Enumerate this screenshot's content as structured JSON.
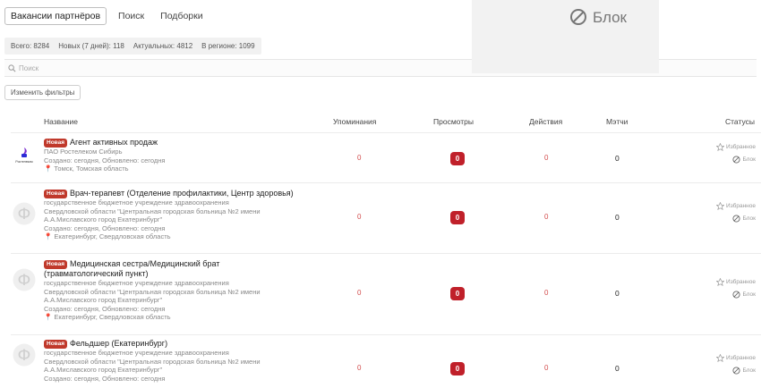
{
  "tabs": [
    {
      "label": "Вакансии партнёров",
      "active": true
    },
    {
      "label": "Поиск",
      "active": false
    },
    {
      "label": "Подборки",
      "active": false
    }
  ],
  "stats": [
    "Всего: 8284",
    "Новых (7 дней): 118",
    "Актуальных: 4812",
    "В регионе: 1099"
  ],
  "search": {
    "placeholder": "Поиск"
  },
  "filters_button": "Изменить фильтры",
  "overlay": {
    "label": "Блок"
  },
  "columns": {
    "name": "Название",
    "mentions": "Упоминания",
    "views": "Просмотры",
    "actions": "Действия",
    "matches": "Мэтчи",
    "statuses": "Статусы"
  },
  "badge_new": "Новая",
  "status_labels": {
    "favorite": "Избранное",
    "block": "Блок"
  },
  "rostelecom_logo_text": "Ростелеком",
  "colors": {
    "accent_red": "#c0202a",
    "badge_red": "#c0392b"
  },
  "vacancies": [
    {
      "title_lines": [
        "Агент активных продаж"
      ],
      "details": [
        "ПАО Ростелеком Сибирь",
        "Создано: сегодня, Обновлено: сегодня",
        "📍 Томск, Томская область"
      ],
      "logo": "rostelecom-logo",
      "mentions": "0",
      "views": "0",
      "actions": "0",
      "matches": "0"
    },
    {
      "title_lines": [
        "Врач-терапевт (Отделение профилактики, Центр здоровья)"
      ],
      "details": [
        "государственное бюджетное учреждение здравоохранения",
        "Свердловской области \"Центральная городская больница №2 имени",
        "А.А.Миславского город Екатеринбург\"",
        "Создано: сегодня, Обновлено: сегодня",
        "📍 Екатеринбург, Свердловская область"
      ],
      "logo": "f-logo",
      "mentions": "0",
      "views": "0",
      "actions": "0",
      "matches": "0"
    },
    {
      "title_lines": [
        "Медицинская сестра/Медицинский брат",
        "(травматологический пункт)"
      ],
      "details": [
        "государственное бюджетное учреждение здравоохранения",
        "Свердловской области \"Центральная городская больница №2 имени",
        "А.А.Миславского город Екатеринбург\"",
        "Создано: сегодня, Обновлено: сегодня",
        "📍 Екатеринбург, Свердловская область"
      ],
      "logo": "f-logo",
      "mentions": "0",
      "views": "0",
      "actions": "0",
      "matches": "0"
    },
    {
      "title_lines": [
        "Фельдшер (Екатеринбург)"
      ],
      "details": [
        "государственное бюджетное учреждение здравоохранения",
        "Свердловской области \"Центральная городская больница №2 имени",
        "А.А.Миславского город Екатеринбург\"",
        "Создано: сегодня, Обновлено: сегодня"
      ],
      "logo": "f-logo",
      "mentions": "0",
      "views": "0",
      "actions": "0",
      "matches": "0"
    }
  ]
}
